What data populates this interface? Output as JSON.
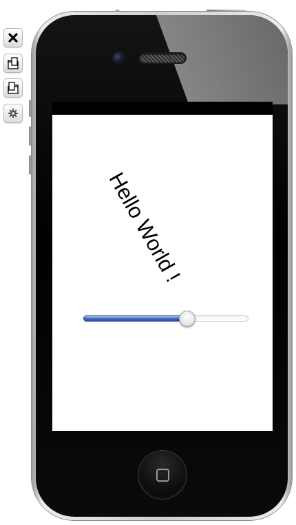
{
  "toolbar": {
    "buttons": [
      {
        "icon": "close-icon"
      },
      {
        "icon": "rotate-left-icon"
      },
      {
        "icon": "rotate-right-icon"
      },
      {
        "icon": "gear-icon"
      }
    ]
  },
  "screen": {
    "label_text": "Hello World !",
    "label_rotation_deg": 60.5,
    "slider": {
      "value": 0.63,
      "min": 0,
      "max": 1,
      "accent_color": "#3f68bf"
    }
  },
  "colors": {
    "phone_face": "#000000",
    "screen_bg": "#ffffff",
    "status_bar": "#000000"
  }
}
